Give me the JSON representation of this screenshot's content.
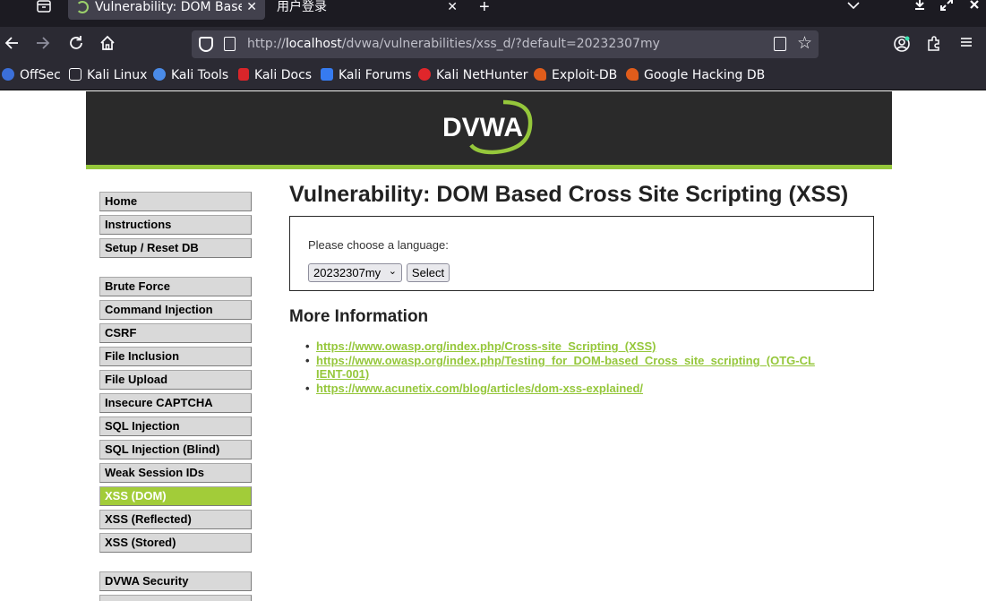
{
  "browser": {
    "tabs": [
      {
        "title": "Vulnerability: DOM Based Cross Site Scripting (XSS) :: Damn Vulnerable Web Application (DVWA)",
        "active": true
      },
      {
        "title": "用户登录",
        "active": false
      }
    ],
    "url": {
      "scheme": "http://",
      "host": "localhost",
      "path": "/dvwa/vulnerabilities/xss_d/?default=20232307my"
    },
    "bookmarks": [
      {
        "label": "OffSec",
        "icon": "offsec-icon",
        "color": "#3b6fd9"
      },
      {
        "label": "Kali Linux",
        "icon": "kali-dragon-icon",
        "color": "#fbfbfe"
      },
      {
        "label": "Kali Tools",
        "icon": "kali-tools-icon",
        "color": "#4a8be8"
      },
      {
        "label": "Kali Docs",
        "icon": "kali-docs-icon",
        "color": "#d9252a"
      },
      {
        "label": "Kali Forums",
        "icon": "kali-forums-icon",
        "color": "#367bf0"
      },
      {
        "label": "Kali NetHunter",
        "icon": "nethunter-icon",
        "color": "#e0262b"
      },
      {
        "label": "Exploit-DB",
        "icon": "exploit-db-icon",
        "color": "#e05c1b"
      },
      {
        "label": "Google Hacking DB",
        "icon": "ghdb-icon",
        "color": "#e05c1b"
      }
    ]
  },
  "dvwa": {
    "logo_text": "DVWA",
    "menu": {
      "group1": [
        "Home",
        "Instructions",
        "Setup / Reset DB"
      ],
      "group2": [
        "Brute Force",
        "Command Injection",
        "CSRF",
        "File Inclusion",
        "File Upload",
        "Insecure CAPTCHA",
        "SQL Injection",
        "SQL Injection (Blind)",
        "Weak Session IDs",
        "XSS (DOM)",
        "XSS (Reflected)",
        "XSS (Stored)"
      ],
      "group3": [
        "DVWA Security"
      ],
      "selected": "XSS (DOM)"
    },
    "title": "Vulnerability: DOM Based Cross Site Scripting (XSS)",
    "form": {
      "prompt": "Please choose a language:",
      "selected_option": "20232307my",
      "button_label": "Select"
    },
    "more_info_title": "More Information",
    "links": [
      "https://www.owasp.org/index.php/Cross-site_Scripting_(XSS)",
      "https://www.owasp.org/index.php/Testing_for_DOM-based_Cross_site_scripting_(OTG-CLIENT-001)",
      "https://www.acunetix.com/blog/articles/dom-xss-explained/"
    ],
    "colors": {
      "accent": "#95c73b",
      "header_bg": "#2a2a2a"
    }
  }
}
